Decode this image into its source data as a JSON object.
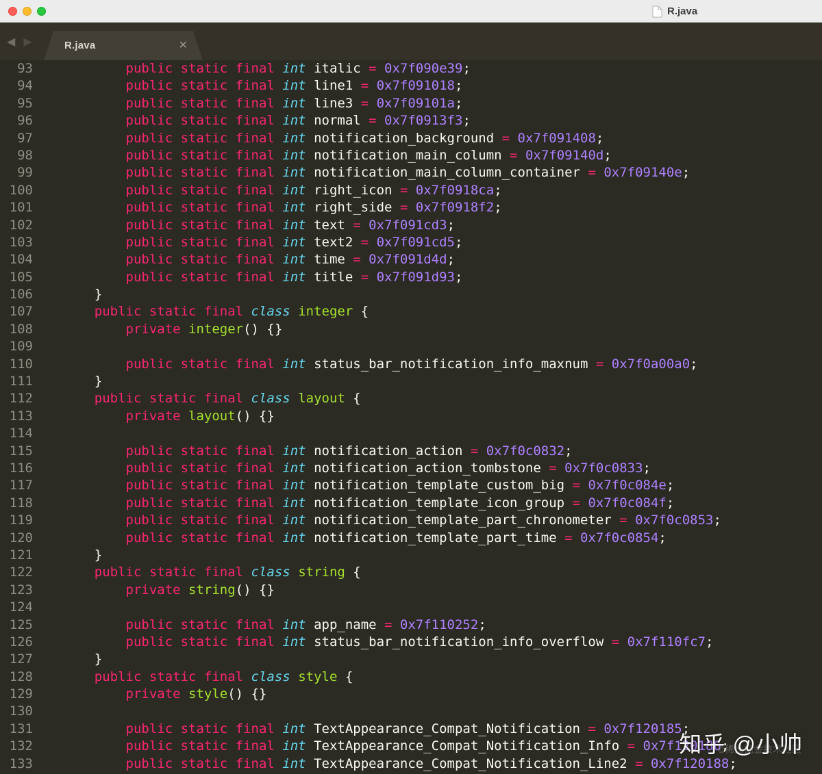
{
  "window": {
    "title": "R.java"
  },
  "tabbar": {
    "back_glyph": "◀",
    "forward_glyph": "▶",
    "tabs": [
      {
        "label": "R.java",
        "close_glyph": "✕"
      }
    ]
  },
  "watermark": {
    "text": "知乎 @小帅",
    "secondary": "©稀土掘金技术社区"
  },
  "colors": {
    "keyword": "#f92672",
    "type": "#66d9ef",
    "plain": "#f8f8f2",
    "operator": "#f92672",
    "number": "#ae81ff",
    "classname": "#a6e22e",
    "editor_bg": "#2b2a23",
    "gutter": "#8f8e84",
    "tabbar_bg": "#343129",
    "tab_bg": "#413f36"
  },
  "code": {
    "lines": [
      {
        "n": "93",
        "t": [
          [
            "        public static final ",
            "kw"
          ],
          [
            "int",
            "ty"
          ],
          [
            " italic ",
            "pl"
          ],
          [
            "=",
            "op"
          ],
          [
            " 0x7f090e39",
            "nu"
          ],
          [
            ";",
            "pl"
          ]
        ]
      },
      {
        "n": "94",
        "t": [
          [
            "        public static final ",
            "kw"
          ],
          [
            "int",
            "ty"
          ],
          [
            " line1 ",
            "pl"
          ],
          [
            "=",
            "op"
          ],
          [
            " 0x7f091018",
            "nu"
          ],
          [
            ";",
            "pl"
          ]
        ]
      },
      {
        "n": "95",
        "t": [
          [
            "        public static final ",
            "kw"
          ],
          [
            "int",
            "ty"
          ],
          [
            " line3 ",
            "pl"
          ],
          [
            "=",
            "op"
          ],
          [
            " 0x7f09101a",
            "nu"
          ],
          [
            ";",
            "pl"
          ]
        ]
      },
      {
        "n": "96",
        "t": [
          [
            "        public static final ",
            "kw"
          ],
          [
            "int",
            "ty"
          ],
          [
            " normal ",
            "pl"
          ],
          [
            "=",
            "op"
          ],
          [
            " 0x7f0913f3",
            "nu"
          ],
          [
            ";",
            "pl"
          ]
        ]
      },
      {
        "n": "97",
        "t": [
          [
            "        public static final ",
            "kw"
          ],
          [
            "int",
            "ty"
          ],
          [
            " notification_background ",
            "pl"
          ],
          [
            "=",
            "op"
          ],
          [
            " 0x7f091408",
            "nu"
          ],
          [
            ";",
            "pl"
          ]
        ]
      },
      {
        "n": "98",
        "t": [
          [
            "        public static final ",
            "kw"
          ],
          [
            "int",
            "ty"
          ],
          [
            " notification_main_column ",
            "pl"
          ],
          [
            "=",
            "op"
          ],
          [
            " 0x7f09140d",
            "nu"
          ],
          [
            ";",
            "pl"
          ]
        ]
      },
      {
        "n": "99",
        "t": [
          [
            "        public static final ",
            "kw"
          ],
          [
            "int",
            "ty"
          ],
          [
            " notification_main_column_container ",
            "pl"
          ],
          [
            "=",
            "op"
          ],
          [
            " 0x7f09140e",
            "nu"
          ],
          [
            ";",
            "pl"
          ]
        ]
      },
      {
        "n": "100",
        "t": [
          [
            "        public static final ",
            "kw"
          ],
          [
            "int",
            "ty"
          ],
          [
            " right_icon ",
            "pl"
          ],
          [
            "=",
            "op"
          ],
          [
            " 0x7f0918ca",
            "nu"
          ],
          [
            ";",
            "pl"
          ]
        ]
      },
      {
        "n": "101",
        "t": [
          [
            "        public static final ",
            "kw"
          ],
          [
            "int",
            "ty"
          ],
          [
            " right_side ",
            "pl"
          ],
          [
            "=",
            "op"
          ],
          [
            " 0x7f0918f2",
            "nu"
          ],
          [
            ";",
            "pl"
          ]
        ]
      },
      {
        "n": "102",
        "t": [
          [
            "        public static final ",
            "kw"
          ],
          [
            "int",
            "ty"
          ],
          [
            " text ",
            "pl"
          ],
          [
            "=",
            "op"
          ],
          [
            " 0x7f091cd3",
            "nu"
          ],
          [
            ";",
            "pl"
          ]
        ]
      },
      {
        "n": "103",
        "t": [
          [
            "        public static final ",
            "kw"
          ],
          [
            "int",
            "ty"
          ],
          [
            " text2 ",
            "pl"
          ],
          [
            "=",
            "op"
          ],
          [
            " 0x7f091cd5",
            "nu"
          ],
          [
            ";",
            "pl"
          ]
        ]
      },
      {
        "n": "104",
        "t": [
          [
            "        public static final ",
            "kw"
          ],
          [
            "int",
            "ty"
          ],
          [
            " time ",
            "pl"
          ],
          [
            "=",
            "op"
          ],
          [
            " 0x7f091d4d",
            "nu"
          ],
          [
            ";",
            "pl"
          ]
        ]
      },
      {
        "n": "105",
        "t": [
          [
            "        public static final ",
            "kw"
          ],
          [
            "int",
            "ty"
          ],
          [
            " title ",
            "pl"
          ],
          [
            "=",
            "op"
          ],
          [
            " 0x7f091d93",
            "nu"
          ],
          [
            ";",
            "pl"
          ]
        ]
      },
      {
        "n": "106",
        "t": [
          [
            "    }",
            "pl"
          ]
        ]
      },
      {
        "n": "107",
        "t": [
          [
            "    public static final ",
            "kw"
          ],
          [
            "class",
            "ty"
          ],
          [
            " ",
            "pl"
          ],
          [
            "integer",
            "cl"
          ],
          [
            " {",
            "pl"
          ]
        ]
      },
      {
        "n": "108",
        "t": [
          [
            "        private ",
            "kw"
          ],
          [
            "integer",
            "cl"
          ],
          [
            "() {}",
            "pl"
          ]
        ]
      },
      {
        "n": "109",
        "t": []
      },
      {
        "n": "110",
        "t": [
          [
            "        public static final ",
            "kw"
          ],
          [
            "int",
            "ty"
          ],
          [
            " status_bar_notification_info_maxnum ",
            "pl"
          ],
          [
            "=",
            "op"
          ],
          [
            " 0x7f0a00a0",
            "nu"
          ],
          [
            ";",
            "pl"
          ]
        ]
      },
      {
        "n": "111",
        "t": [
          [
            "    }",
            "pl"
          ]
        ]
      },
      {
        "n": "112",
        "t": [
          [
            "    public static final ",
            "kw"
          ],
          [
            "class",
            "ty"
          ],
          [
            " ",
            "pl"
          ],
          [
            "layout",
            "cl"
          ],
          [
            " {",
            "pl"
          ]
        ]
      },
      {
        "n": "113",
        "t": [
          [
            "        private ",
            "kw"
          ],
          [
            "layout",
            "cl"
          ],
          [
            "() {}",
            "pl"
          ]
        ]
      },
      {
        "n": "114",
        "t": []
      },
      {
        "n": "115",
        "t": [
          [
            "        public static final ",
            "kw"
          ],
          [
            "int",
            "ty"
          ],
          [
            " notification_action ",
            "pl"
          ],
          [
            "=",
            "op"
          ],
          [
            " 0x7f0c0832",
            "nu"
          ],
          [
            ";",
            "pl"
          ]
        ]
      },
      {
        "n": "116",
        "t": [
          [
            "        public static final ",
            "kw"
          ],
          [
            "int",
            "ty"
          ],
          [
            " notification_action_tombstone ",
            "pl"
          ],
          [
            "=",
            "op"
          ],
          [
            " 0x7f0c0833",
            "nu"
          ],
          [
            ";",
            "pl"
          ]
        ]
      },
      {
        "n": "117",
        "t": [
          [
            "        public static final ",
            "kw"
          ],
          [
            "int",
            "ty"
          ],
          [
            " notification_template_custom_big ",
            "pl"
          ],
          [
            "=",
            "op"
          ],
          [
            " 0x7f0c084e",
            "nu"
          ],
          [
            ";",
            "pl"
          ]
        ]
      },
      {
        "n": "118",
        "t": [
          [
            "        public static final ",
            "kw"
          ],
          [
            "int",
            "ty"
          ],
          [
            " notification_template_icon_group ",
            "pl"
          ],
          [
            "=",
            "op"
          ],
          [
            " 0x7f0c084f",
            "nu"
          ],
          [
            ";",
            "pl"
          ]
        ]
      },
      {
        "n": "119",
        "t": [
          [
            "        public static final ",
            "kw"
          ],
          [
            "int",
            "ty"
          ],
          [
            " notification_template_part_chronometer ",
            "pl"
          ],
          [
            "=",
            "op"
          ],
          [
            " 0x7f0c0853",
            "nu"
          ],
          [
            ";",
            "pl"
          ]
        ]
      },
      {
        "n": "120",
        "t": [
          [
            "        public static final ",
            "kw"
          ],
          [
            "int",
            "ty"
          ],
          [
            " notification_template_part_time ",
            "pl"
          ],
          [
            "=",
            "op"
          ],
          [
            " 0x7f0c0854",
            "nu"
          ],
          [
            ";",
            "pl"
          ]
        ]
      },
      {
        "n": "121",
        "t": [
          [
            "    }",
            "pl"
          ]
        ]
      },
      {
        "n": "122",
        "t": [
          [
            "    public static final ",
            "kw"
          ],
          [
            "class",
            "ty"
          ],
          [
            " ",
            "pl"
          ],
          [
            "string",
            "cl"
          ],
          [
            " {",
            "pl"
          ]
        ]
      },
      {
        "n": "123",
        "t": [
          [
            "        private ",
            "kw"
          ],
          [
            "string",
            "cl"
          ],
          [
            "() {}",
            "pl"
          ]
        ]
      },
      {
        "n": "124",
        "t": []
      },
      {
        "n": "125",
        "t": [
          [
            "        public static final ",
            "kw"
          ],
          [
            "int",
            "ty"
          ],
          [
            " app_name ",
            "pl"
          ],
          [
            "=",
            "op"
          ],
          [
            " 0x7f110252",
            "nu"
          ],
          [
            ";",
            "pl"
          ]
        ]
      },
      {
        "n": "126",
        "t": [
          [
            "        public static final ",
            "kw"
          ],
          [
            "int",
            "ty"
          ],
          [
            " status_bar_notification_info_overflow ",
            "pl"
          ],
          [
            "=",
            "op"
          ],
          [
            " 0x7f110fc7",
            "nu"
          ],
          [
            ";",
            "pl"
          ]
        ]
      },
      {
        "n": "127",
        "t": [
          [
            "    }",
            "pl"
          ]
        ]
      },
      {
        "n": "128",
        "t": [
          [
            "    public static final ",
            "kw"
          ],
          [
            "class",
            "ty"
          ],
          [
            " ",
            "pl"
          ],
          [
            "style",
            "cl"
          ],
          [
            " {",
            "pl"
          ]
        ]
      },
      {
        "n": "129",
        "t": [
          [
            "        private ",
            "kw"
          ],
          [
            "style",
            "cl"
          ],
          [
            "() {}",
            "pl"
          ]
        ]
      },
      {
        "n": "130",
        "t": []
      },
      {
        "n": "131",
        "t": [
          [
            "        public static final ",
            "kw"
          ],
          [
            "int",
            "ty"
          ],
          [
            " TextAppearance_Compat_Notification ",
            "pl"
          ],
          [
            "=",
            "op"
          ],
          [
            " 0x7f120185",
            "nu"
          ],
          [
            ";",
            "pl"
          ]
        ]
      },
      {
        "n": "132",
        "t": [
          [
            "        public static final ",
            "kw"
          ],
          [
            "int",
            "ty"
          ],
          [
            " TextAppearance_Compat_Notification_Info ",
            "pl"
          ],
          [
            "=",
            "op"
          ],
          [
            " 0x7f120186",
            "nu"
          ],
          [
            ";",
            "pl"
          ]
        ]
      },
      {
        "n": "133",
        "t": [
          [
            "        public static final ",
            "kw"
          ],
          [
            "int",
            "ty"
          ],
          [
            " TextAppearance_Compat_Notification_Line2 ",
            "pl"
          ],
          [
            "=",
            "op"
          ],
          [
            " 0x7f120188",
            "nu"
          ],
          [
            ";",
            "pl"
          ]
        ]
      }
    ]
  }
}
